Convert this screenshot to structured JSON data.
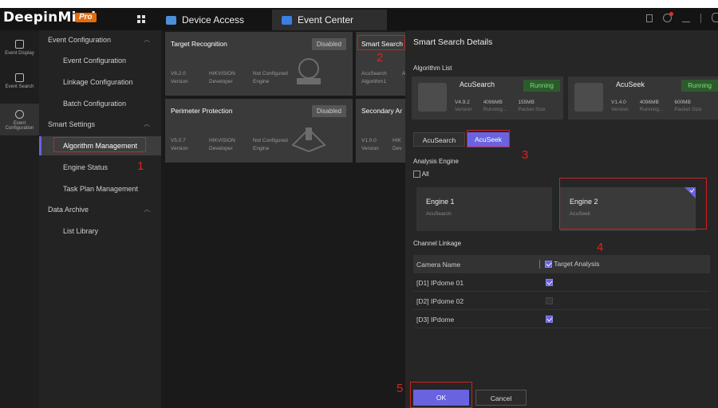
{
  "app": {
    "brand": "DeepinMind",
    "badge": "Pro"
  },
  "tabs": [
    {
      "label": "Device Access",
      "color": "#4a8fd8"
    },
    {
      "label": "Event Center",
      "color": "#3b7fe0"
    }
  ],
  "nav": [
    {
      "label": "Event Display"
    },
    {
      "label": "Event Search"
    },
    {
      "label": "Event Configuration"
    }
  ],
  "menu": {
    "group1": "Event Configuration",
    "event_configuration": "Event Configuration",
    "linkage_configuration": "Linkage Configuration",
    "batch_configuration": "Batch Configuration",
    "group2": "Smart Settings",
    "algorithm_management": "Algorithm Management",
    "engine_status": "Engine Status",
    "task_plan_management": "Task Plan Management",
    "group3": "Data Archive",
    "list_library": "List Library"
  },
  "cards": {
    "target_recognition": {
      "title": "Target Recognition",
      "status": "Disabled",
      "version": "V6.2.0",
      "developer": "HIKVISION",
      "engine": "Not Configured",
      "l_version": "Version",
      "l_developer": "Developer",
      "l_engine": "Engine"
    },
    "perimeter_protection": {
      "title": "Perimeter Protection",
      "status": "Disabled",
      "version": "V5.0.7",
      "developer": "HIKVISION",
      "engine": "Not Configured",
      "l_version": "Version",
      "l_developer": "Developer",
      "l_engine": "Engine"
    },
    "smart_search": {
      "title": "Smart Search",
      "v1": "AcuSearch",
      "v1_label": "Algorithm1",
      "v2": "A"
    },
    "secondary": {
      "title": "Secondary Ar",
      "v1": "V1.0.0",
      "v1_label": "Version",
      "v2": "HIK",
      "v2_label": "Dev"
    }
  },
  "panel": {
    "title": "Smart Search Details",
    "algorithm_list_label": "Algorithm List",
    "algorithms": [
      {
        "name": "AcuSearch",
        "status": "Running",
        "version": "V4.9.2",
        "memory": "4096MB",
        "packet": "155MB",
        "l_version": "Version",
        "l_memory": "Running...",
        "l_packet": "Packet Size"
      },
      {
        "name": "AcuSeek",
        "status": "Running",
        "version": "V1.4.0",
        "memory": "4096MB",
        "packet": "600MB",
        "l_version": "Version",
        "l_memory": "Running...",
        "l_packet": "Packet Size"
      }
    ],
    "algo_tabs": [
      "AcuSearch",
      "AcuSeek"
    ],
    "analysis_engine_label": "Analysis Engine",
    "all_label": "All",
    "engines": [
      {
        "name": "Engine 1",
        "algo": "AcuSearch"
      },
      {
        "name": "Engine 2",
        "algo": "AcuSeek"
      }
    ],
    "channel_linkage_label": "Channel Linkage",
    "table_headers": {
      "camera": "Camera Name",
      "target": "Target Analysis"
    },
    "cameras": [
      {
        "name": "[D1] IPdome 01",
        "checked": true
      },
      {
        "name": "[D2] IPdome 02",
        "checked": false
      },
      {
        "name": "[D3] IPdome",
        "checked": true
      }
    ],
    "ok_label": "OK",
    "cancel_label": "Cancel"
  },
  "annotations": [
    "1",
    "2",
    "3",
    "4",
    "5"
  ],
  "colors": {
    "accent": "#6a63e0",
    "highlight": "#d02020",
    "running": "#7fde7f"
  }
}
